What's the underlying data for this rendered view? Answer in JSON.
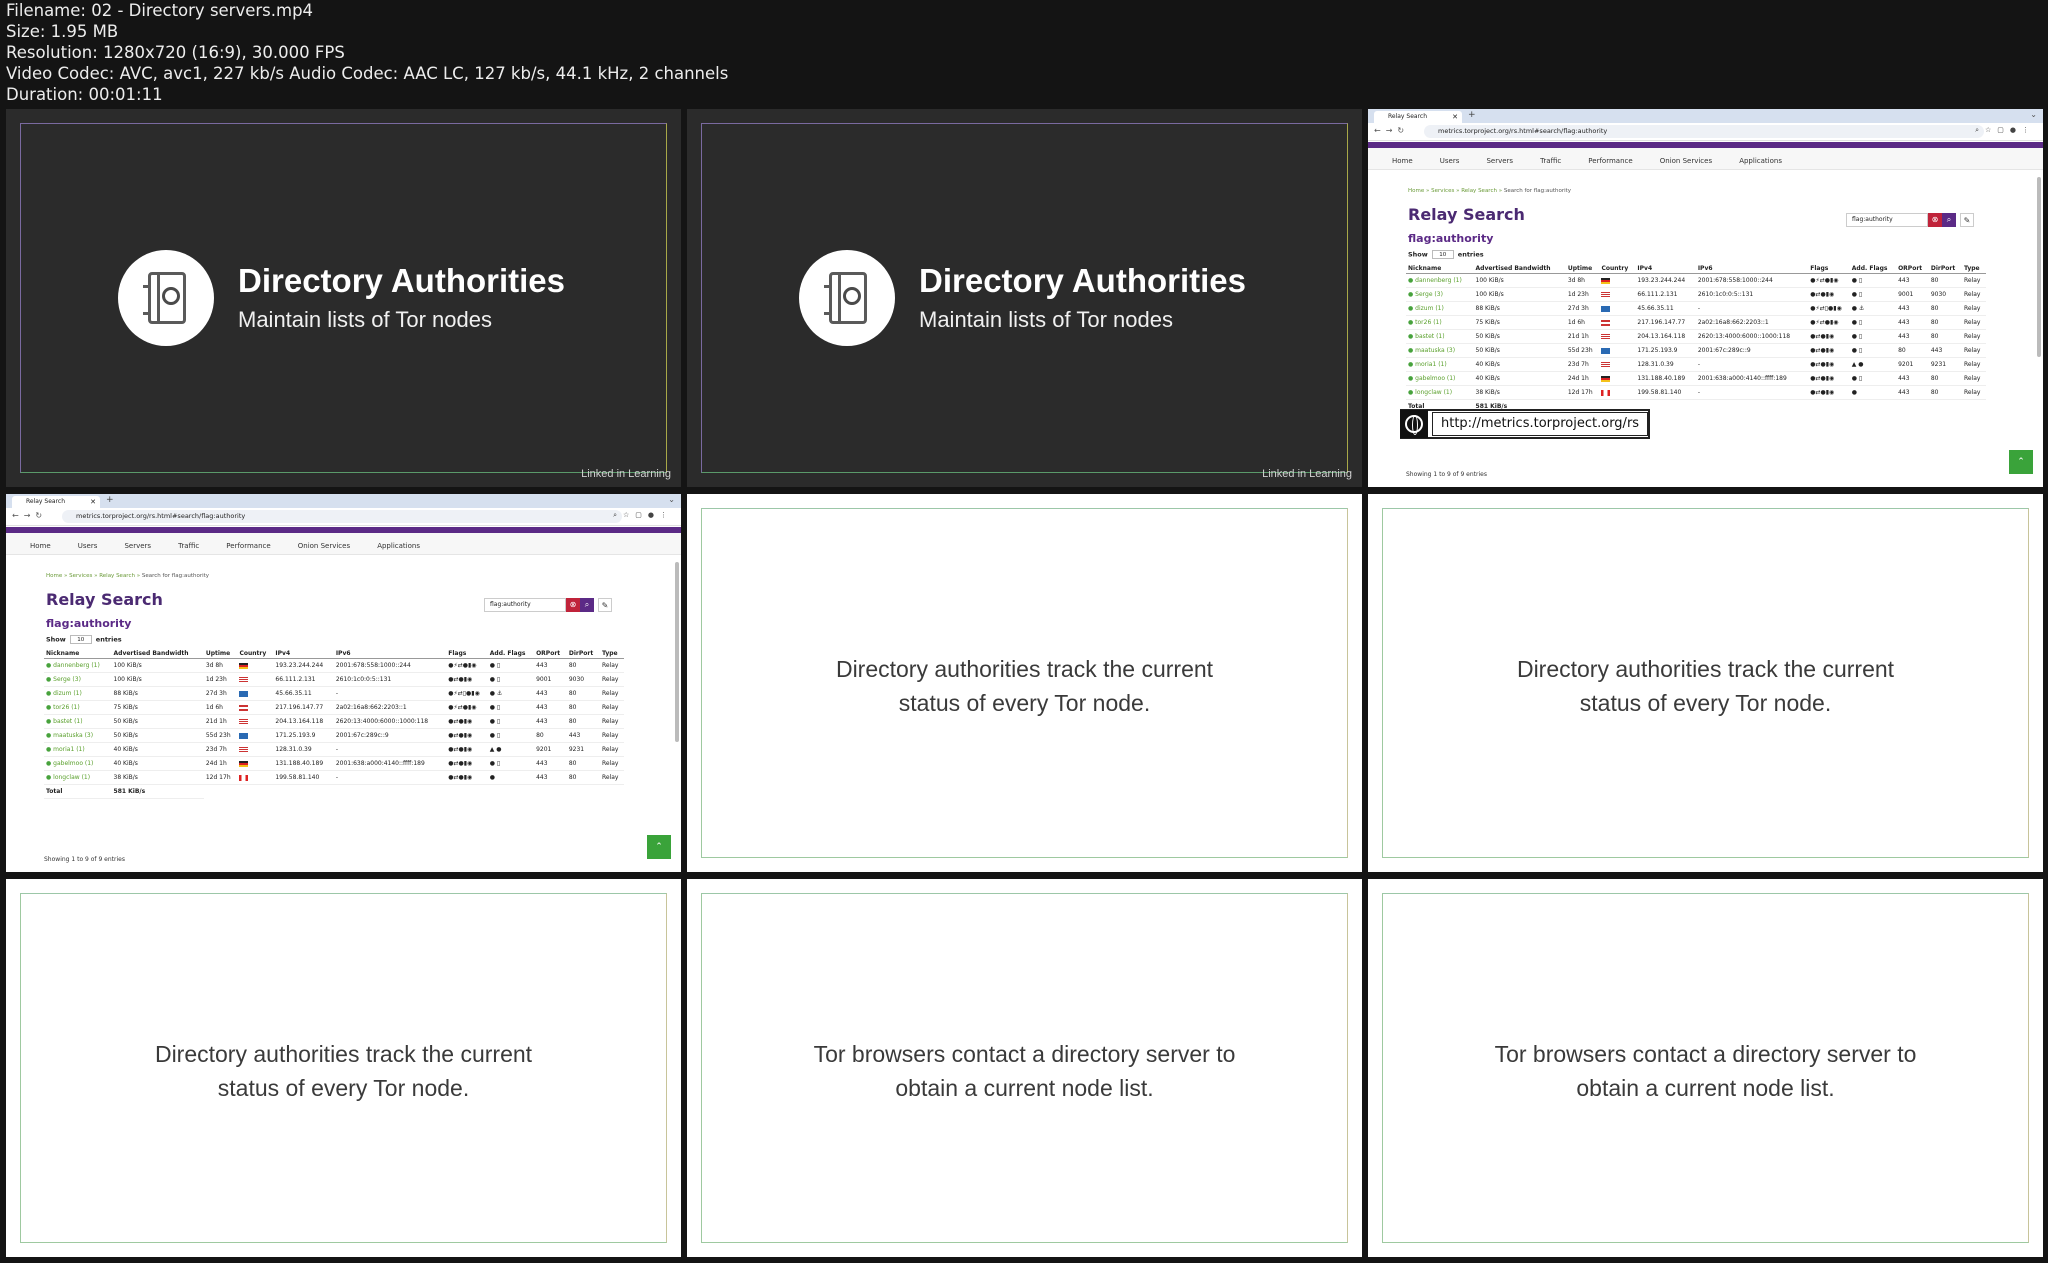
{
  "meta": {
    "filename": "Filename: 02 - Directory servers.mp4",
    "size": "Size: 1.95 MB",
    "resolution": "Resolution: 1280x720 (16:9), 30.000 FPS",
    "codec": "Video Codec: AVC, avc1, 227 kb/s Audio Codec: AAC LC, 127 kb/s, 44.1 kHz, 2 channels",
    "duration": "Duration: 00:01:11"
  },
  "title_slide": {
    "title": "Directory Authorities",
    "subtitle": "Maintain lists of Tor nodes",
    "watermark": "Linked in Learning",
    "icon": "address-book-phone-icon"
  },
  "slides": {
    "track_line1": "Directory authorities track the current",
    "track_line2": "status of every Tor node.",
    "contact_line1": "Tor browsers contact a directory server to",
    "contact_line2": "obtain a current node list."
  },
  "browser": {
    "tab_title": "Relay Search",
    "url": "metrics.torproject.org/rs.html#search/flag:authority",
    "menu": [
      "Home",
      "Users",
      "Servers",
      "Traffic",
      "Performance",
      "Onion Services",
      "Applications"
    ],
    "breadcrumb": [
      "Home",
      "Services",
      "Relay Search"
    ],
    "breadcrumb_tail": "Search for flag:authority",
    "heading": "Relay Search",
    "subheading": "flag:authority",
    "search_value": "flag:authority",
    "show_label": "Show",
    "show_value": "10",
    "entries_label": "entries",
    "columns": [
      "Nickname",
      "Advertised Bandwidth",
      "Uptime",
      "Country",
      "IPv4",
      "IPv6",
      "Flags",
      "Add. Flags",
      "ORPort",
      "DirPort",
      "Type"
    ],
    "rows": [
      {
        "nick": "dannenberg (1)",
        "bw": "100 KiB/s",
        "up": "3d 8h",
        "cc": "de",
        "ipv4": "193.23.244.244",
        "ipv6": "2001:678:558:1000::244",
        "flags": "●⚡⇄●▮◉",
        "add": "● ▯",
        "or": "443",
        "dir": "80",
        "type": "Relay"
      },
      {
        "nick": "Serge (3)",
        "bw": "100 KiB/s",
        "up": "1d 23h",
        "cc": "us",
        "ipv4": "66.111.2.131",
        "ipv6": "2610:1c0:0:5::131",
        "flags": "●⇄●▮◉",
        "add": "● ▯",
        "or": "9001",
        "dir": "9030",
        "type": "Relay"
      },
      {
        "nick": "dizum (1)",
        "bw": "88 KiB/s",
        "up": "27d 3h",
        "cc": "se",
        "ipv4": "45.66.35.11",
        "ipv6": "-",
        "flags": "●⚡⇄▯●▮◉",
        "add": "● ⚓",
        "or": "443",
        "dir": "80",
        "type": "Relay"
      },
      {
        "nick": "tor26 (1)",
        "bw": "75 KiB/s",
        "up": "1d 6h",
        "cc": "at",
        "ipv4": "217.196.147.77",
        "ipv6": "2a02:16a8:662:2203::1",
        "flags": "●⚡⇄●▮◉",
        "add": "● ▯",
        "or": "443",
        "dir": "80",
        "type": "Relay"
      },
      {
        "nick": "bastet (1)",
        "bw": "50 KiB/s",
        "up": "21d 1h",
        "cc": "us",
        "ipv4": "204.13.164.118",
        "ipv6": "2620:13:4000:6000::1000:118",
        "flags": "●⇄●▮◉",
        "add": "● ▯",
        "or": "443",
        "dir": "80",
        "type": "Relay"
      },
      {
        "nick": "maatuska (3)",
        "bw": "50 KiB/s",
        "up": "55d 23h",
        "cc": "se",
        "ipv4": "171.25.193.9",
        "ipv6": "2001:67c:289c::9",
        "flags": "●⇄●▮◉",
        "add": "● ▯",
        "or": "80",
        "dir": "443",
        "type": "Relay"
      },
      {
        "nick": "moria1 (1)",
        "bw": "40 KiB/s",
        "up": "23d 7h",
        "cc": "us",
        "ipv4": "128.31.0.39",
        "ipv6": "-",
        "flags": "●⇄●▮◉",
        "add": "▲ ●",
        "or": "9201",
        "dir": "9231",
        "type": "Relay"
      },
      {
        "nick": "gabelmoo (1)",
        "bw": "40 KiB/s",
        "up": "24d 1h",
        "cc": "de",
        "ipv4": "131.188.40.189",
        "ipv6": "2001:638:a000:4140::ffff:189",
        "flags": "●⇄●▮◉",
        "add": "● ▯",
        "or": "443",
        "dir": "80",
        "type": "Relay"
      },
      {
        "nick": "longclaw (1)",
        "bw": "38 KiB/s",
        "up": "12d 17h",
        "cc": "ca",
        "ipv4": "199.58.81.140",
        "ipv6": "-",
        "flags": "●⇄●▮◉",
        "add": "●",
        "or": "443",
        "dir": "80",
        "type": "Relay"
      }
    ],
    "total_label": "Total",
    "total_bw": "581 KiB/s",
    "showing": "Showing 1 to 9 of 9 entries"
  },
  "overlay_url": "http://metrics.torproject.org/rs",
  "colors": {
    "brand_purple": "#5b2a86",
    "link_green": "#5aa02c",
    "dark_slide": "#2b2b2b"
  }
}
